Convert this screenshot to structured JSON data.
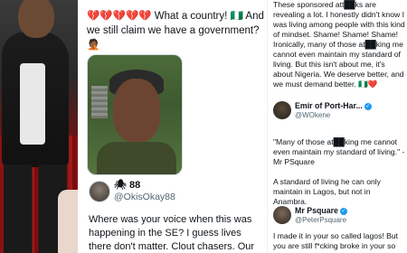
{
  "middle": {
    "tweet_text": "💔💔💔💔💔 What a country! 🇳🇬 And we still claim we have a government?🤦🏾",
    "user": {
      "name": "88",
      "handle": "@OkisOkay88"
    },
    "reply_text": "Where was your voice when this was happening in the SE? I guess lives there don't matter. Clout chasers. Our"
  },
  "right": {
    "top_text": "These sponsored att██ks are revealing a lot. I honestly didn't know I was living among people with this kind of mindset. Shame! Shame! Shame! Ironically, many of those at██king me cannot even maintain my standard of living. But this isn't about me, it's about Nigeria. We deserve better, and we must demand better. 🇳🇬❤️",
    "emir": {
      "name": "Emir of Port-Har...",
      "handle": "@WOkene"
    },
    "quote": "\"Many of those at██king me cannot even maintain my standard of living.\" - Mr PSquare",
    "standard": "A standard of living he can only maintain in Lagos, but not in Anambra.",
    "psquare": {
      "name": "Mr Psquare",
      "handle": "@PeterPsquare"
    },
    "bottom_text": "I made it in your so called lagos! But you are still f*cking broke in your so called"
  },
  "icons": {
    "verified": "verified-badge-icon"
  },
  "colors": {
    "link_blue": "#1d9bf0",
    "text": "#0f1419",
    "muted": "#536471"
  }
}
